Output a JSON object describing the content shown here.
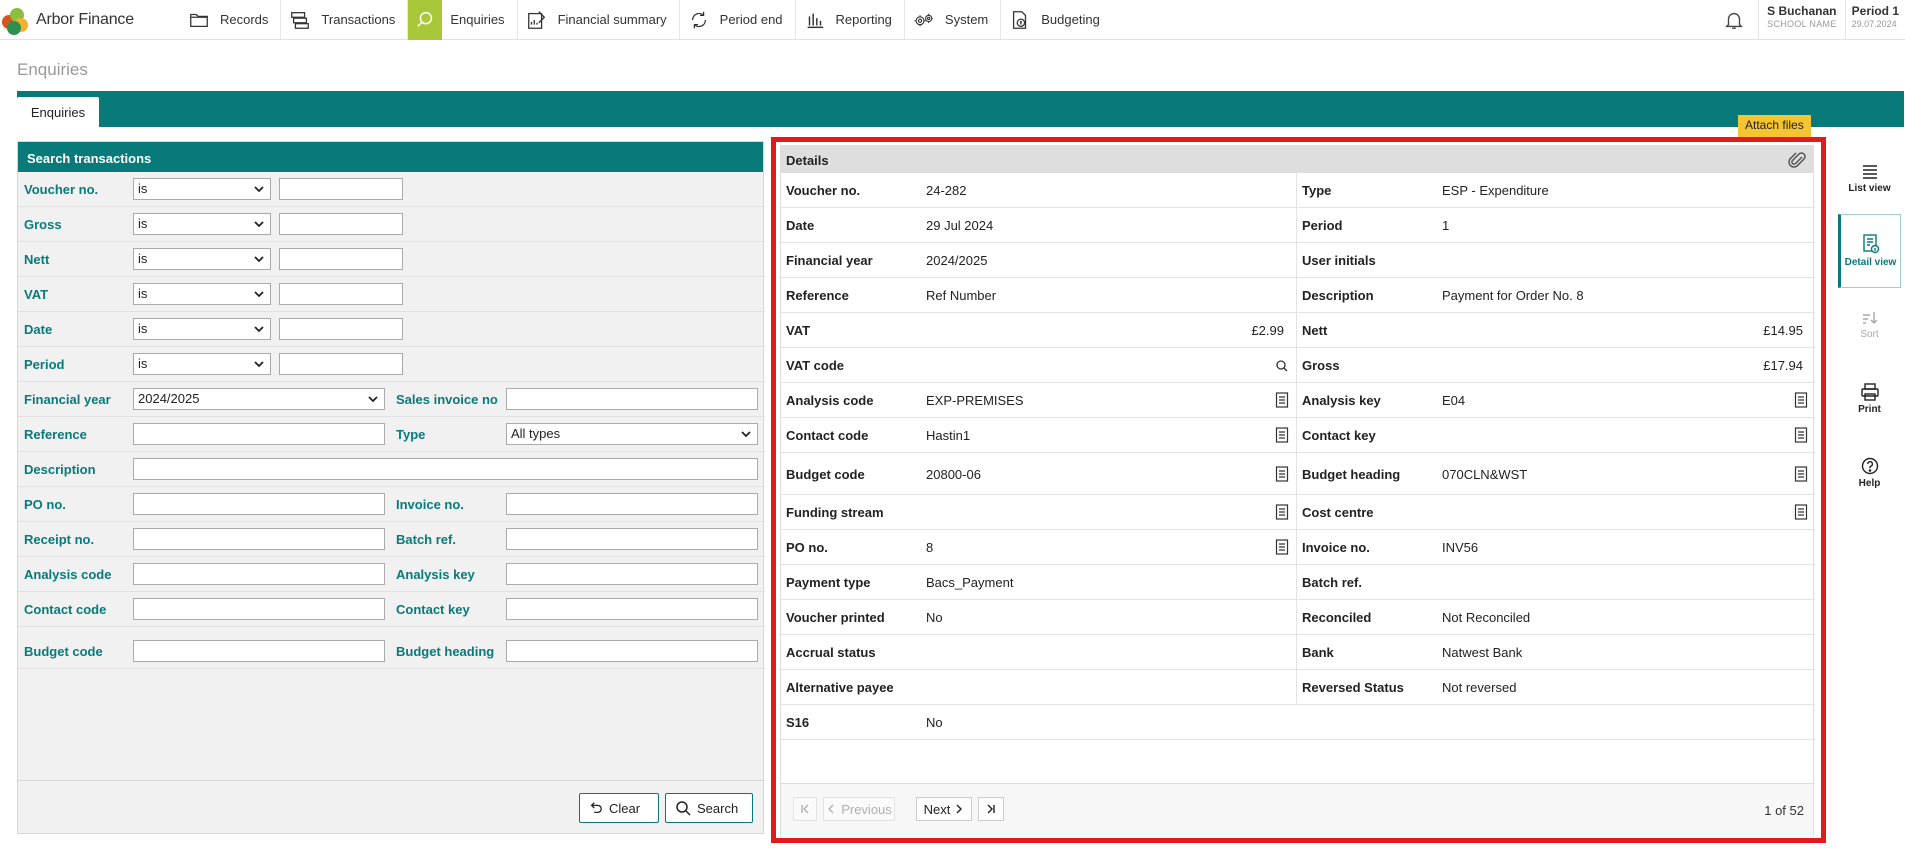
{
  "app": {
    "name": "Arbor Finance"
  },
  "nav": [
    {
      "id": "records",
      "label": "Records",
      "icon": "folder-icon"
    },
    {
      "id": "transactions",
      "label": "Transactions",
      "icon": "stack-icon"
    },
    {
      "id": "enquiries",
      "label": "Enquiries",
      "icon": "search-icon",
      "active": true
    },
    {
      "id": "financial-summary",
      "label": "Financial summary",
      "icon": "document-chart-icon"
    },
    {
      "id": "period-end",
      "label": "Period end",
      "icon": "cycle-icon"
    },
    {
      "id": "reporting",
      "label": "Reporting",
      "icon": "bar-chart-icon"
    },
    {
      "id": "system",
      "label": "System",
      "icon": "gears-icon"
    },
    {
      "id": "budgeting",
      "label": "Budgeting",
      "icon": "budget-document-icon"
    }
  ],
  "user": {
    "name": "S Buchanan",
    "school": "SCHOOL NAME"
  },
  "period": {
    "label": "Period 1",
    "date": "29.07.2024"
  },
  "page": {
    "title": "Enquiries",
    "tab": "Enquiries"
  },
  "search": {
    "title": "Search transactions",
    "operator_rows": [
      {
        "label": "Voucher no.",
        "operator": "is",
        "value": ""
      },
      {
        "label": "Gross",
        "operator": "is",
        "value": ""
      },
      {
        "label": "Nett",
        "operator": "is",
        "value": ""
      },
      {
        "label": "VAT",
        "operator": "is",
        "value": ""
      },
      {
        "label": "Date",
        "operator": "is",
        "value": ""
      },
      {
        "label": "Period",
        "operator": "is",
        "value": ""
      }
    ],
    "financial_year": {
      "label": "Financial year",
      "value": "2024/2025"
    },
    "sales_invoice": {
      "label": "Sales invoice no",
      "value": ""
    },
    "reference": {
      "label": "Reference",
      "value": ""
    },
    "type": {
      "label": "Type",
      "value": "All types"
    },
    "description": {
      "label": "Description",
      "value": ""
    },
    "po_no": {
      "label": "PO no.",
      "value": ""
    },
    "invoice_no": {
      "label": "Invoice no.",
      "value": ""
    },
    "receipt_no": {
      "label": "Receipt no.",
      "value": ""
    },
    "batch_ref": {
      "label": "Batch ref.",
      "value": ""
    },
    "analysis_code": {
      "label": "Analysis code",
      "value": ""
    },
    "analysis_key": {
      "label": "Analysis key",
      "value": ""
    },
    "contact_code": {
      "label": "Contact code",
      "value": ""
    },
    "contact_key": {
      "label": "Contact key",
      "value": ""
    },
    "budget_code": {
      "label": "Budget code",
      "value": ""
    },
    "budget_heading": {
      "label": "Budget heading",
      "value": ""
    },
    "clear_label": "Clear",
    "search_label": "Search"
  },
  "details": {
    "title": "Details",
    "attach_label": "Attach files",
    "rows": [
      {
        "l": {
          "label": "Voucher no.",
          "value": "24-282"
        },
        "r": {
          "label": "Type",
          "value": "ESP - Expenditure"
        }
      },
      {
        "l": {
          "label": "Date",
          "value": "29 Jul 2024"
        },
        "r": {
          "label": "Period",
          "value": "1"
        }
      },
      {
        "l": {
          "label": "Financial year",
          "value": "2024/2025"
        },
        "r": {
          "label": "User initials",
          "value": ""
        }
      },
      {
        "l": {
          "label": "Reference",
          "value": "Ref Number"
        },
        "r": {
          "label": "Description",
          "value": "Payment for Order No. 8"
        }
      },
      {
        "l": {
          "label": "VAT",
          "value": "£2.99"
        },
        "r": {
          "label": "Nett",
          "value": "£14.95"
        }
      },
      {
        "l": {
          "label": "VAT code",
          "value": ""
        },
        "r": {
          "label": "Gross",
          "value": "£17.94"
        }
      },
      {
        "l": {
          "label": "Analysis code",
          "value": "EXP-PREMISES"
        },
        "r": {
          "label": "Analysis key",
          "value": "E04"
        }
      },
      {
        "l": {
          "label": "Contact code",
          "value": "Hastin1"
        },
        "r": {
          "label": "Contact key",
          "value": ""
        }
      },
      {
        "l": {
          "label": "Budget code",
          "value": "20800-06"
        },
        "r": {
          "label": "Budget heading",
          "value": "070CLN&WST"
        }
      },
      {
        "l": {
          "label": "Funding stream",
          "value": ""
        },
        "r": {
          "label": "Cost centre",
          "value": ""
        }
      },
      {
        "l": {
          "label": "PO no.",
          "value": "8"
        },
        "r": {
          "label": "Invoice no.",
          "value": "INV56"
        }
      },
      {
        "l": {
          "label": "Payment type",
          "value": "Bacs_Payment"
        },
        "r": {
          "label": "Batch ref.",
          "value": ""
        }
      },
      {
        "l": {
          "label": "Voucher printed",
          "value": "No"
        },
        "r": {
          "label": "Reconciled",
          "value": "Not Reconciled"
        }
      },
      {
        "l": {
          "label": "Accrual status",
          "value": ""
        },
        "r": {
          "label": "Bank",
          "value": "Natwest Bank"
        }
      },
      {
        "l": {
          "label": "Alternative payee",
          "value": ""
        },
        "r": {
          "label": "Reversed Status",
          "value": "Not reversed"
        }
      },
      {
        "l": {
          "label": "S16",
          "value": "No"
        },
        "r": null
      }
    ],
    "pager": {
      "previous": "Previous",
      "next": "Next",
      "count": "1 of 52"
    }
  },
  "sidebar_tools": [
    {
      "label": "List view",
      "icon": "list-icon"
    },
    {
      "label": "Detail view",
      "icon": "detail-view-icon",
      "active": true
    },
    {
      "label": "Sort",
      "icon": "sort-icon",
      "disabled": true
    },
    {
      "label": "Print",
      "icon": "printer-icon"
    },
    {
      "label": "Help",
      "icon": "help-icon"
    }
  ]
}
